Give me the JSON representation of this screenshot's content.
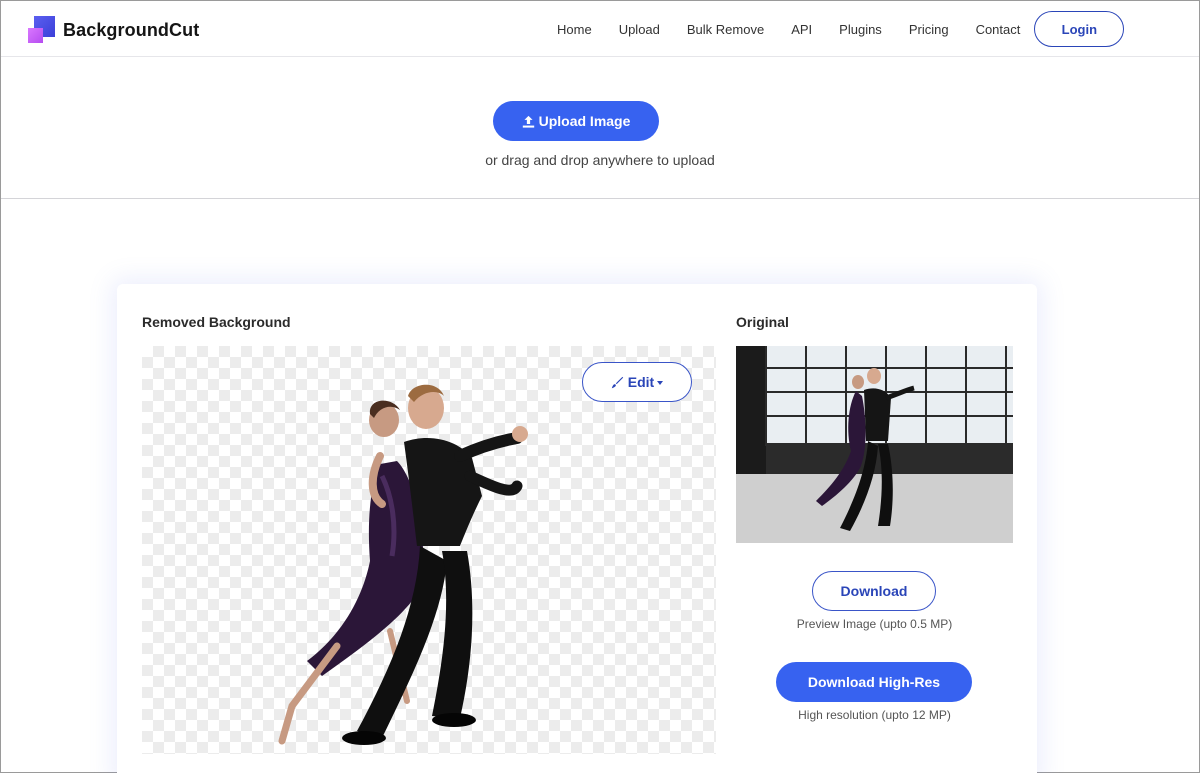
{
  "brand": {
    "name": "BackgroundCut"
  },
  "nav": {
    "items": [
      {
        "label": "Home"
      },
      {
        "label": "Upload"
      },
      {
        "label": "Bulk Remove"
      },
      {
        "label": "API"
      },
      {
        "label": "Plugins"
      },
      {
        "label": "Pricing"
      },
      {
        "label": "Contact"
      }
    ],
    "login_label": "Login"
  },
  "upload": {
    "button_label": "Upload Image",
    "hint": "or drag and drop anywhere to upload"
  },
  "result": {
    "removed_label": "Removed Background",
    "edit_label": "Edit",
    "original_label": "Original",
    "download_label": "Download",
    "download_sub": "Preview Image (upto 0.5 MP)",
    "download_hr_label": "Download High-Res",
    "download_hr_sub": "High resolution (upto 12 MP)"
  },
  "colors": {
    "primary": "#3762f0",
    "outline": "#2a45b8"
  }
}
